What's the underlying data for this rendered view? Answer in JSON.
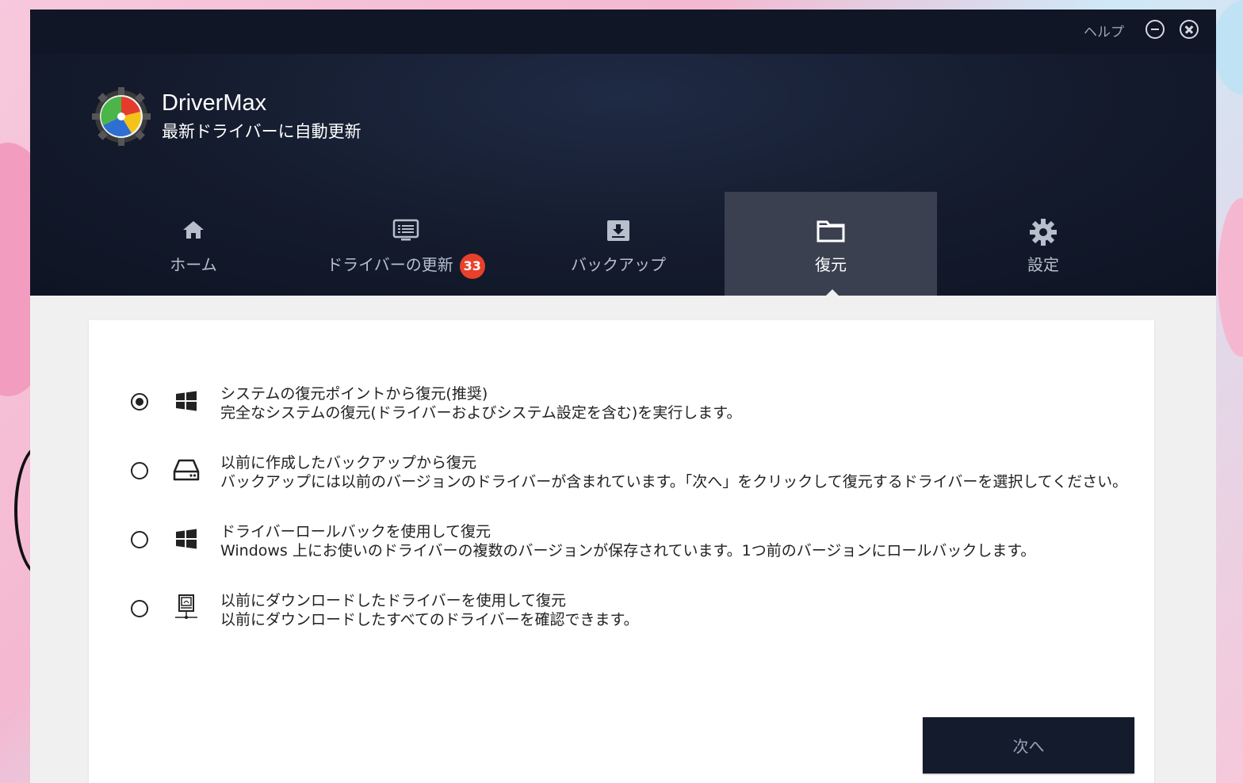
{
  "titlebar": {
    "help_label": "ヘルプ"
  },
  "app": {
    "name": "DriverMax",
    "tagline": "最新ドライバーに自動更新"
  },
  "nav": {
    "tabs": [
      {
        "label": "ホーム",
        "icon": "home-icon"
      },
      {
        "label": "ドライバーの更新",
        "icon": "driver-list-icon",
        "badge": "33"
      },
      {
        "label": "バックアップ",
        "icon": "backup-download-icon"
      },
      {
        "label": "復元",
        "icon": "folder-icon",
        "active": true
      },
      {
        "label": "設定",
        "icon": "gear-icon"
      }
    ]
  },
  "restore_options": [
    {
      "title": "システムの復元ポイントから復元(推奨)",
      "desc": "完全なシステムの復元(ドライバーおよびシステム設定を含む)を実行します。",
      "icon": "windows-icon",
      "selected": true
    },
    {
      "title": "以前に作成したバックアップから復元",
      "desc": "バックアップには以前のバージョンのドライバーが含まれています。「次へ」をクリックして復元するドライバーを選択してください。",
      "icon": "hard-drive-icon",
      "selected": false
    },
    {
      "title": "ドライバーロールバックを使用して復元",
      "desc": "Windows 上にお使いのドライバーの複数のバージョンが保存されています。1つ前のバージョンにロールバックします。",
      "icon": "windows-icon",
      "selected": false
    },
    {
      "title": "以前にダウンロードしたドライバーを使用して復元",
      "desc": "以前にダウンロードしたすべてのドライバーを確認できます。",
      "icon": "network-drive-icon",
      "selected": false
    }
  ],
  "footer": {
    "next_label": "次へ"
  },
  "colors": {
    "header_bg": "#141b2d",
    "active_tab": "#3b4051",
    "badge": "#e8402b",
    "button_bg": "#141b2d"
  }
}
